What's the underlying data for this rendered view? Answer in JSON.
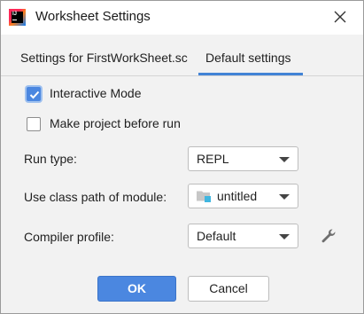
{
  "window": {
    "title": "Worksheet Settings"
  },
  "tabs": [
    {
      "label": "Settings for FirstWorkSheet.sc",
      "active": false
    },
    {
      "label": "Default settings",
      "active": true
    }
  ],
  "options": {
    "interactive_mode": {
      "label": "Interactive Mode",
      "checked": true
    },
    "make_project": {
      "label": "Make project before run",
      "checked": false
    }
  },
  "fields": {
    "run_type": {
      "label": "Run type:",
      "value": "REPL"
    },
    "class_path": {
      "label": "Use class path of module:",
      "value": "untitled"
    },
    "compiler_profile": {
      "label": "Compiler profile:",
      "value": "Default"
    }
  },
  "buttons": {
    "ok": "OK",
    "cancel": "Cancel"
  },
  "icons": {
    "app": "intellij-icon",
    "close": "close-icon",
    "module": "module-folder-icon",
    "settings": "wrench-icon"
  },
  "colors": {
    "accent": "#4b87e0",
    "tab_underline": "#4283d6",
    "background": "#f2f2f2"
  }
}
